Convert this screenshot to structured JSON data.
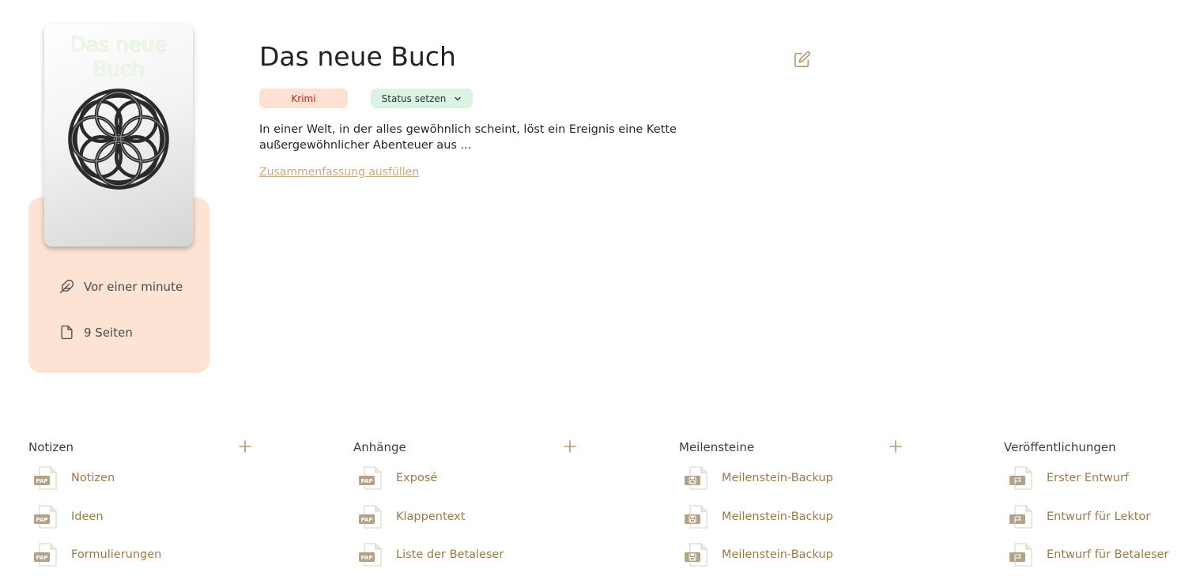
{
  "colors": {
    "accent": "#b5976a",
    "link": "#c9a882",
    "genre_bg": "#fde1d3",
    "genre_text": "#b3261e",
    "status_bg": "#daf3e2",
    "panel_bg": "#fde3d4"
  },
  "book": {
    "cover_title": "Das neue Buch",
    "title": "Das neue Buch",
    "genre": "Krimi",
    "status_label": "Status setzen",
    "summary": "In einer Welt, in der alles gewöhnlich scheint, löst ein Ereignis eine Kette außergewöhnlicher Abenteuer aus ...",
    "summary_link": "Zusammenfassung ausfüllen"
  },
  "meta": {
    "last_edited": "Vor einer minute",
    "pages": "9 Seiten"
  },
  "sections": {
    "notes": {
      "title": "Notizen",
      "icon": "pap-doc-icon",
      "items": [
        "Notizen",
        "Ideen",
        "Formulierungen"
      ]
    },
    "attachments": {
      "title": "Anhänge",
      "icon": "pap-doc-icon",
      "items": [
        "Exposé",
        "Klappentext",
        "Liste der Betaleser"
      ]
    },
    "milestones": {
      "title": "Meilensteine",
      "icon": "backup-doc-icon",
      "items": [
        "Meilenstein-Backup",
        "Meilenstein-Backup",
        "Meilenstein-Backup"
      ]
    },
    "publications": {
      "title": "Veröffentlichungen",
      "icon": "flag-doc-icon",
      "items": [
        "Erster Entwurf",
        "Entwurf für Lektor",
        "Entwurf für Betaleser"
      ]
    }
  }
}
